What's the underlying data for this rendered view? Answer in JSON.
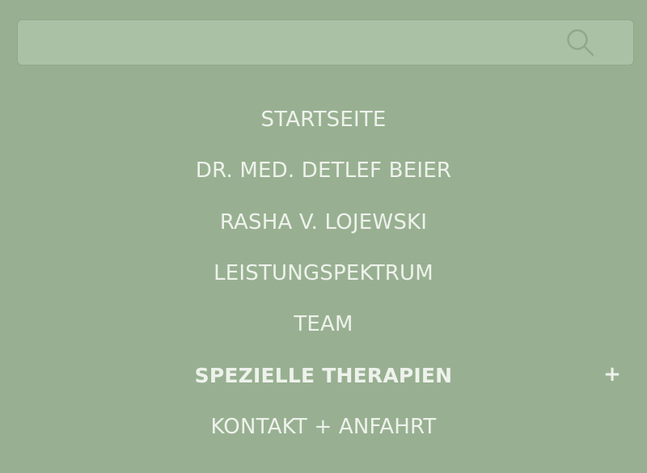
{
  "search": {
    "placeholder": "",
    "value": "",
    "icon": "search-icon"
  },
  "menu": {
    "items": [
      {
        "label": "STARTSEITE",
        "active": false
      },
      {
        "label": "DR. MED. DETLEF BEIER",
        "active": false
      },
      {
        "label": "RASHA V. LOJEWSKI",
        "active": false
      },
      {
        "label": "LEISTUNGSPEKTRUM",
        "active": false
      },
      {
        "label": "TEAM",
        "active": false
      },
      {
        "label": "SPEZIELLE THERAPIEN",
        "active": true,
        "expand_label": "+"
      },
      {
        "label": "KONTAKT + ANFAHRT",
        "active": false
      }
    ]
  },
  "colors": {
    "background": "#98b091",
    "search_background": "#abc1a5",
    "text": "#eef2ec"
  }
}
